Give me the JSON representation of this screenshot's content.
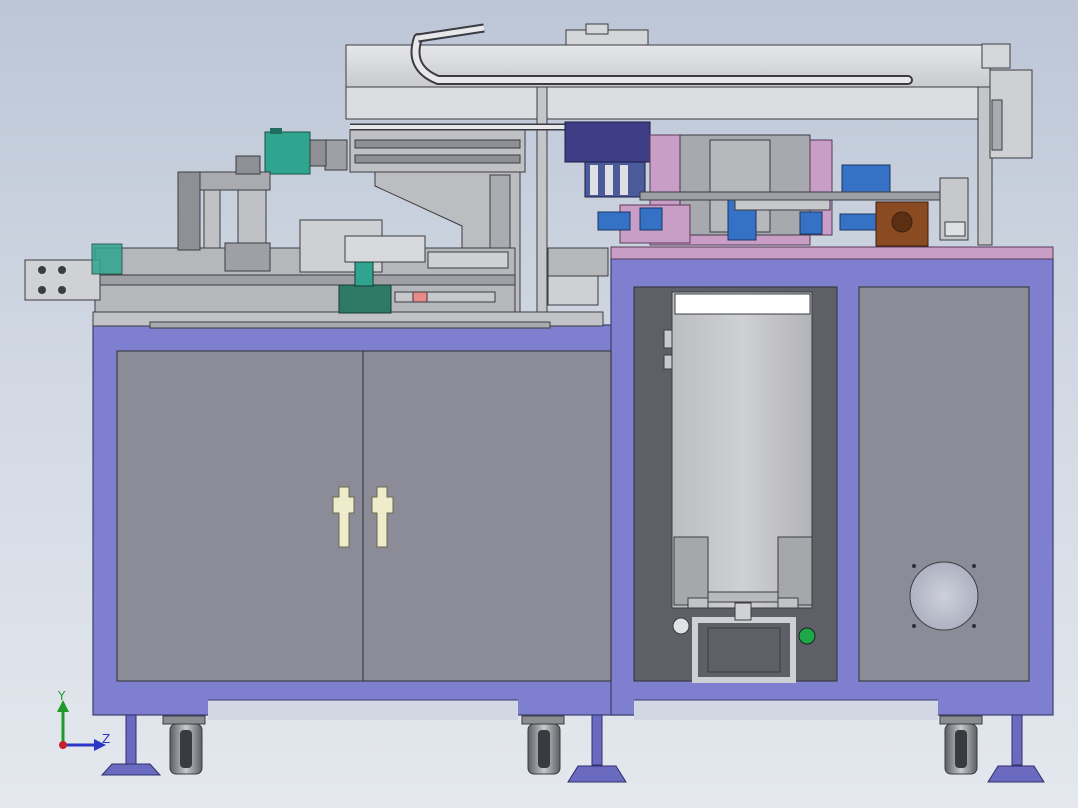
{
  "view": {
    "background_top": "#bcc6d6",
    "background_bottom": "#e4e8ee"
  },
  "colors": {
    "cabinet_frame": "#7f7fcf",
    "cabinet_panel": "#8b8c97",
    "door_handle": "#efeccb",
    "steel_light": "#d9dadd",
    "steel_mid": "#a9abb0",
    "steel_dark": "#6f7176",
    "motor_teal": "#2fa58f",
    "cylinder_blue": "#3572c6",
    "plate_pink": "#c89ec6",
    "navy_block": "#3f3d86",
    "brown_motor": "#8a4b22",
    "indicator_green": "#1ea84a",
    "caster_base": "#6a6ac0"
  },
  "triad": {
    "y_label": "Y",
    "z_label": "Z",
    "y_color": "#1f9a2b",
    "z_color": "#2a36c8"
  }
}
